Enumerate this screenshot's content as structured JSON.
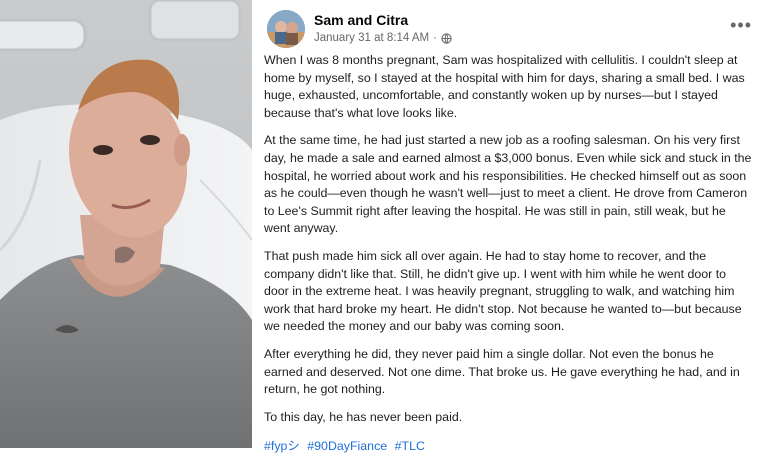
{
  "post": {
    "author": "Sam and Citra",
    "timestamp": "January 31 at 8:14 AM",
    "separator": "·",
    "privacy_icon": "globe-icon",
    "more_icon": "more-options-icon",
    "more_label": "•••",
    "paragraphs": [
      "When I was 8 months pregnant, Sam was hospitalized with cellulitis. I couldn't sleep at home by myself, so I stayed at the hospital with him for days, sharing a small bed. I was huge, exhausted, uncomfortable, and constantly woken up by nurses—but I stayed because that's what love looks like.",
      "At the same time, he had just started a new job as a roofing salesman. On his very first day, he made a sale and earned almost a $3,000 bonus. Even while sick and stuck in the hospital, he worried about work and his responsibilities. He checked himself out as soon as he could—even though he wasn't well—just to meet a client. He drove from Cameron to Lee's Summit right after leaving the hospital. He was still in pain, still weak, but he went anyway.",
      "That push made him sick all over again. He had to stay home to recover, and the company didn't like that. Still, he didn't give up. I went with him while he went door to door in the extreme heat. I was heavily pregnant, struggling to walk, and watching him work that hard broke my heart. He didn't stop. Not because he wanted to—but because we needed the money and our baby was coming soon.",
      "After everything he did, they never paid him a single dollar. Not even the bonus he earned and deserved. Not one dime. That broke us. He gave everything he had, and in return, he got nothing.",
      "To this day, he has never been paid."
    ],
    "hashtags": [
      "#fypシ",
      "#90DayFiance",
      "#TLC"
    ]
  },
  "colors": {
    "link": "#216fdb",
    "text": "#1c1e21",
    "meta": "#65676b"
  }
}
